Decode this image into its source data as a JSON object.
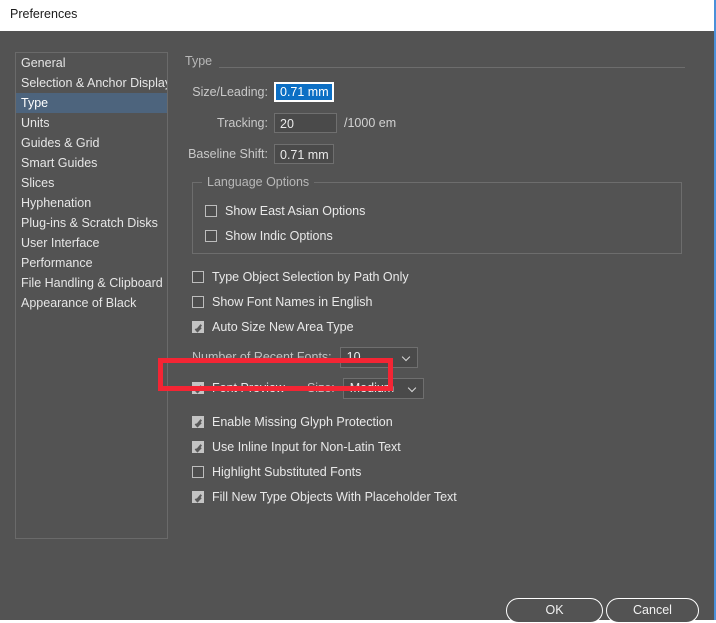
{
  "window": {
    "title": "Preferences",
    "accent_border": "#4a90d9",
    "background": "#535353",
    "selected_item_color": "#4d647d",
    "annotation_color": "#f42534",
    "focus_highlight_color": "#0c6fc4"
  },
  "sidebar": {
    "items": [
      {
        "label": "General",
        "selected": false
      },
      {
        "label": "Selection & Anchor Display",
        "selected": false
      },
      {
        "label": "Type",
        "selected": true
      },
      {
        "label": "Units",
        "selected": false
      },
      {
        "label": "Guides & Grid",
        "selected": false
      },
      {
        "label": "Smart Guides",
        "selected": false
      },
      {
        "label": "Slices",
        "selected": false
      },
      {
        "label": "Hyphenation",
        "selected": false
      },
      {
        "label": "Plug-ins & Scratch Disks",
        "selected": false
      },
      {
        "label": "User Interface",
        "selected": false
      },
      {
        "label": "Performance",
        "selected": false
      },
      {
        "label": "File Handling & Clipboard",
        "selected": false
      },
      {
        "label": "Appearance of Black",
        "selected": false
      }
    ]
  },
  "panel": {
    "title": "Type",
    "fields": {
      "size_leading": {
        "label": "Size/Leading:",
        "value": "0.71 mm",
        "focused": true
      },
      "tracking": {
        "label": "Tracking:",
        "value": "20",
        "suffix": "/1000 em"
      },
      "baseline_shift": {
        "label": "Baseline Shift:",
        "value": "0.71 mm"
      }
    },
    "language_options": {
      "title": "Language Options",
      "items": [
        {
          "label": "Show East Asian Options",
          "checked": false
        },
        {
          "label": "Show Indic Options",
          "checked": false
        }
      ]
    },
    "options": [
      {
        "label": "Type Object Selection by Path Only",
        "checked": false
      },
      {
        "label": "Show Font Names in English",
        "checked": false
      },
      {
        "label": "Auto Size New Area Type",
        "checked": true,
        "highlighted": true
      }
    ],
    "recent_fonts": {
      "label": "Number of Recent Fonts:",
      "value": "10"
    },
    "font_preview": {
      "label": "Font Preview",
      "checked": true,
      "size_label": "Size:",
      "size_value": "Medium"
    },
    "options_lower": [
      {
        "label": "Enable Missing Glyph Protection",
        "checked": true
      },
      {
        "label": "Use Inline Input for Non-Latin Text",
        "checked": true
      },
      {
        "label": "Highlight Substituted Fonts",
        "checked": false
      },
      {
        "label": "Fill New Type Objects With Placeholder Text",
        "checked": true
      }
    ]
  },
  "footer": {
    "ok_label": "OK",
    "cancel_label": "Cancel"
  }
}
